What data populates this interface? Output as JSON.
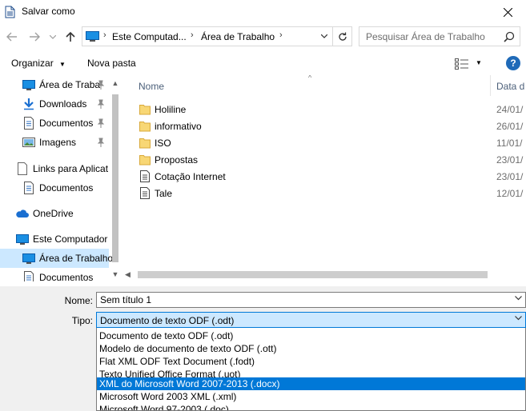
{
  "window": {
    "title": "Salvar como"
  },
  "address": {
    "crumbs": [
      "Este Computad...",
      "Área de Trabalho"
    ],
    "search_placeholder": "Pesquisar Área de Trabalho"
  },
  "toolbar": {
    "organize_label": "Organizar",
    "new_folder_label": "Nova pasta"
  },
  "nav_items": [
    {
      "label": "Área de Traba",
      "icon": "desktop-icon",
      "pinned": true
    },
    {
      "label": "Downloads",
      "icon": "download-icon",
      "pinned": true
    },
    {
      "label": "Documentos",
      "icon": "document-icon",
      "pinned": true
    },
    {
      "label": "Imagens",
      "icon": "image-icon",
      "pinned": true
    },
    {
      "label": "Links para Aplicat",
      "icon": "page-icon",
      "pinned": false
    },
    {
      "label": "Documentos",
      "icon": "document-icon",
      "pinned": false
    },
    {
      "label": "OneDrive",
      "icon": "cloud-icon",
      "pinned": false
    },
    {
      "label": "Este Computador",
      "icon": "computer-icon",
      "pinned": false
    },
    {
      "label": "Área de Trabalho",
      "icon": "desktop-icon",
      "pinned": false,
      "selected": true
    },
    {
      "label": "Documentos",
      "icon": "document-icon",
      "pinned": false
    }
  ],
  "columns": {
    "name": "Nome",
    "date": "Data d"
  },
  "files": [
    {
      "name": "Holiline",
      "date": "24/01/",
      "type": "folder"
    },
    {
      "name": "informativo",
      "date": "26/01/",
      "type": "folder"
    },
    {
      "name": "ISO",
      "date": "11/01/",
      "type": "folder"
    },
    {
      "name": "Propostas",
      "date": "23/01/",
      "type": "folder"
    },
    {
      "name": "Cotação Internet",
      "date": "23/01/",
      "type": "doc"
    },
    {
      "name": "Tale",
      "date": "12/01/",
      "type": "doc"
    }
  ],
  "form": {
    "name_label": "Nome:",
    "name_value": "Sem título 1",
    "type_label": "Tipo:",
    "type_value": "Documento de texto ODF (.odt)"
  },
  "type_options": [
    {
      "label": "Documento de texto ODF (.odt)",
      "selected": false
    },
    {
      "label": "Modelo de documento de texto ODF (.ott)",
      "selected": false
    },
    {
      "label": "Flat XML ODF Text Document (.fodt)",
      "selected": false
    },
    {
      "label": "Texto Unified Office Format (.uot)",
      "selected": false
    },
    {
      "label": "XML do Microsoft Word 2007-2013 (.docx)",
      "selected": true
    },
    {
      "label": "Microsoft Word 2003 XML (.xml)",
      "selected": false
    },
    {
      "label": "Microsoft Word 97-2003 (.doc)",
      "selected": false
    }
  ],
  "colors": {
    "accent": "#0078d7",
    "selection": "#cce8ff",
    "folder": "#f8d775"
  }
}
